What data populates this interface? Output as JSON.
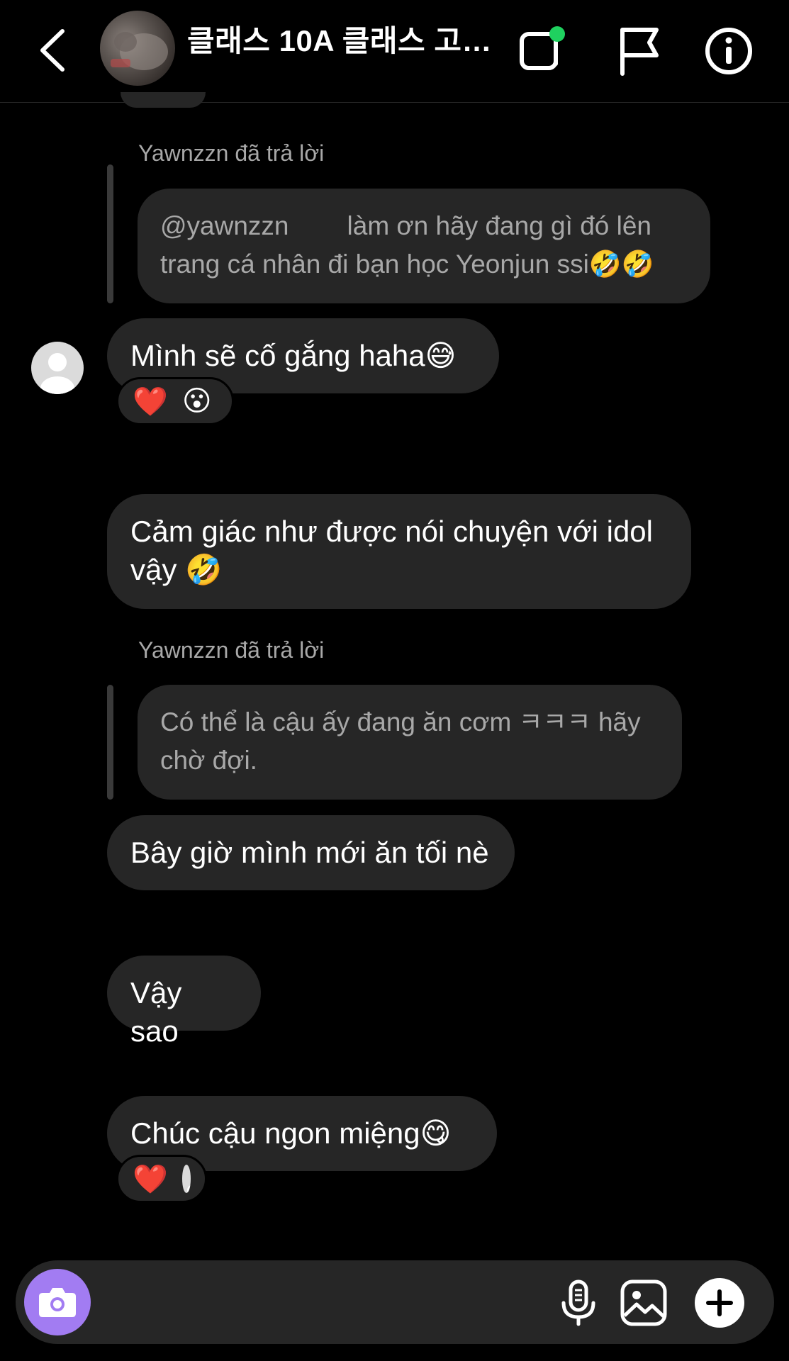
{
  "header": {
    "title": "클래스 10A 클래스 고…",
    "icons": [
      "back-chevron-icon",
      "video-call-icon",
      "flag-icon",
      "info-icon"
    ],
    "video_status_color": "#1fd15f"
  },
  "messages": [
    {
      "reply_label": "Yawnzzn đã trả lời",
      "quoted_mention": "@yawnzzn",
      "quoted_text": "làm ơn hãy đang gì đó lên trang cá nhân đi bạn học Yeonjun ssi🤣🤣",
      "text": "Mình sẽ cố gắng haha😅",
      "reactions": [
        "❤️",
        "😮"
      ]
    },
    {
      "text": "Cảm giác như được nói chuyện với idol vậy 🤣"
    },
    {
      "reply_label": "Yawnzzn đã trả lời",
      "quoted_text": "Có thể là cậu ấy đang ăn cơm ㅋㅋㅋ hãy chờ đợi.",
      "text": "Bây giờ mình mới ăn tối nè"
    },
    {
      "text": "Vậy sao"
    },
    {
      "text": "Chúc cậu ngon miệng😋",
      "reactions": [
        "❤️"
      ]
    }
  ],
  "composer": {
    "icons": [
      "camera-icon",
      "microphone-icon",
      "gallery-icon",
      "plus-icon"
    ],
    "camera_color": "#a27cf2"
  }
}
